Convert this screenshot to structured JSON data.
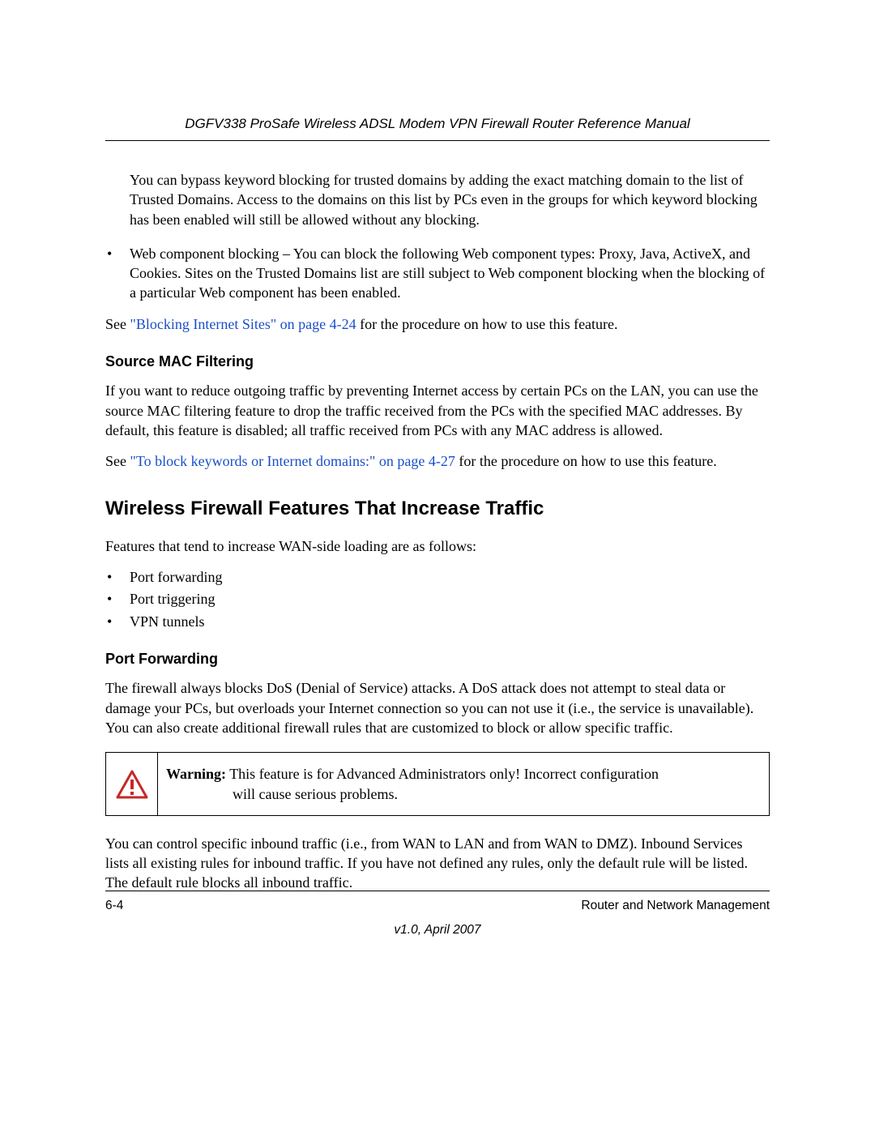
{
  "header": {
    "title": "DGFV338 ProSafe Wireless ADSL Modem VPN Firewall Router Reference Manual"
  },
  "content": {
    "p1": "You can bypass keyword blocking for trusted domains by adding the exact matching domain to the list of Trusted Domains. Access to the domains on this list by PCs even in the groups for which keyword blocking has been enabled will still be allowed without any blocking.",
    "p2": "Web component blocking – You can block the following Web component types: Proxy, Java, ActiveX, and Cookies. Sites on the Trusted Domains list are still subject to Web component blocking when the blocking of a particular Web component has been enabled.",
    "see1_pre": "See ",
    "see1_link": "\"Blocking Internet Sites\" on page 4-24",
    "see1_post": " for the procedure on how to use this feature.",
    "h_macfilter": "Source MAC Filtering",
    "p_macfilter": "If you want to reduce outgoing traffic by preventing Internet access by certain PCs on the LAN, you can use the source MAC filtering feature to drop the traffic received from the PCs with the specified MAC addresses. By default, this feature is disabled; all traffic received from PCs with any MAC address is allowed.",
    "see2_pre": "See ",
    "see2_link": "\"To block keywords or Internet domains:\" on page 4-27",
    "see2_post": " for the procedure on how to use this feature.",
    "h_increase": "Wireless Firewall Features That Increase Traffic",
    "p_increase_intro": "Features that tend to increase WAN-side loading are as follows:",
    "list_increase": [
      "Port forwarding",
      "Port triggering",
      "VPN tunnels"
    ],
    "h_portfwd": "Port Forwarding",
    "p_portfwd": "The firewall always blocks DoS (Denial of Service) attacks. A DoS attack does not attempt to steal data or damage your PCs, but overloads your Internet connection so you can not use it (i.e., the service is unavailable). You can also create additional firewall rules that are customized to block or allow specific traffic.",
    "warning_label": "Warning:",
    "warning_line1": " This feature is for Advanced Administrators only! Incorrect configuration ",
    "warning_line2": "will cause serious problems.",
    "p_inbound": "You can control specific inbound traffic (i.e., from WAN to LAN and from WAN to DMZ). Inbound Services lists all existing rules for inbound traffic. If you have not defined any rules, only the default rule will be listed. The default rule blocks all inbound traffic."
  },
  "footer": {
    "page": "6-4",
    "section": "Router and Network Management",
    "version": "v1.0, April 2007"
  }
}
